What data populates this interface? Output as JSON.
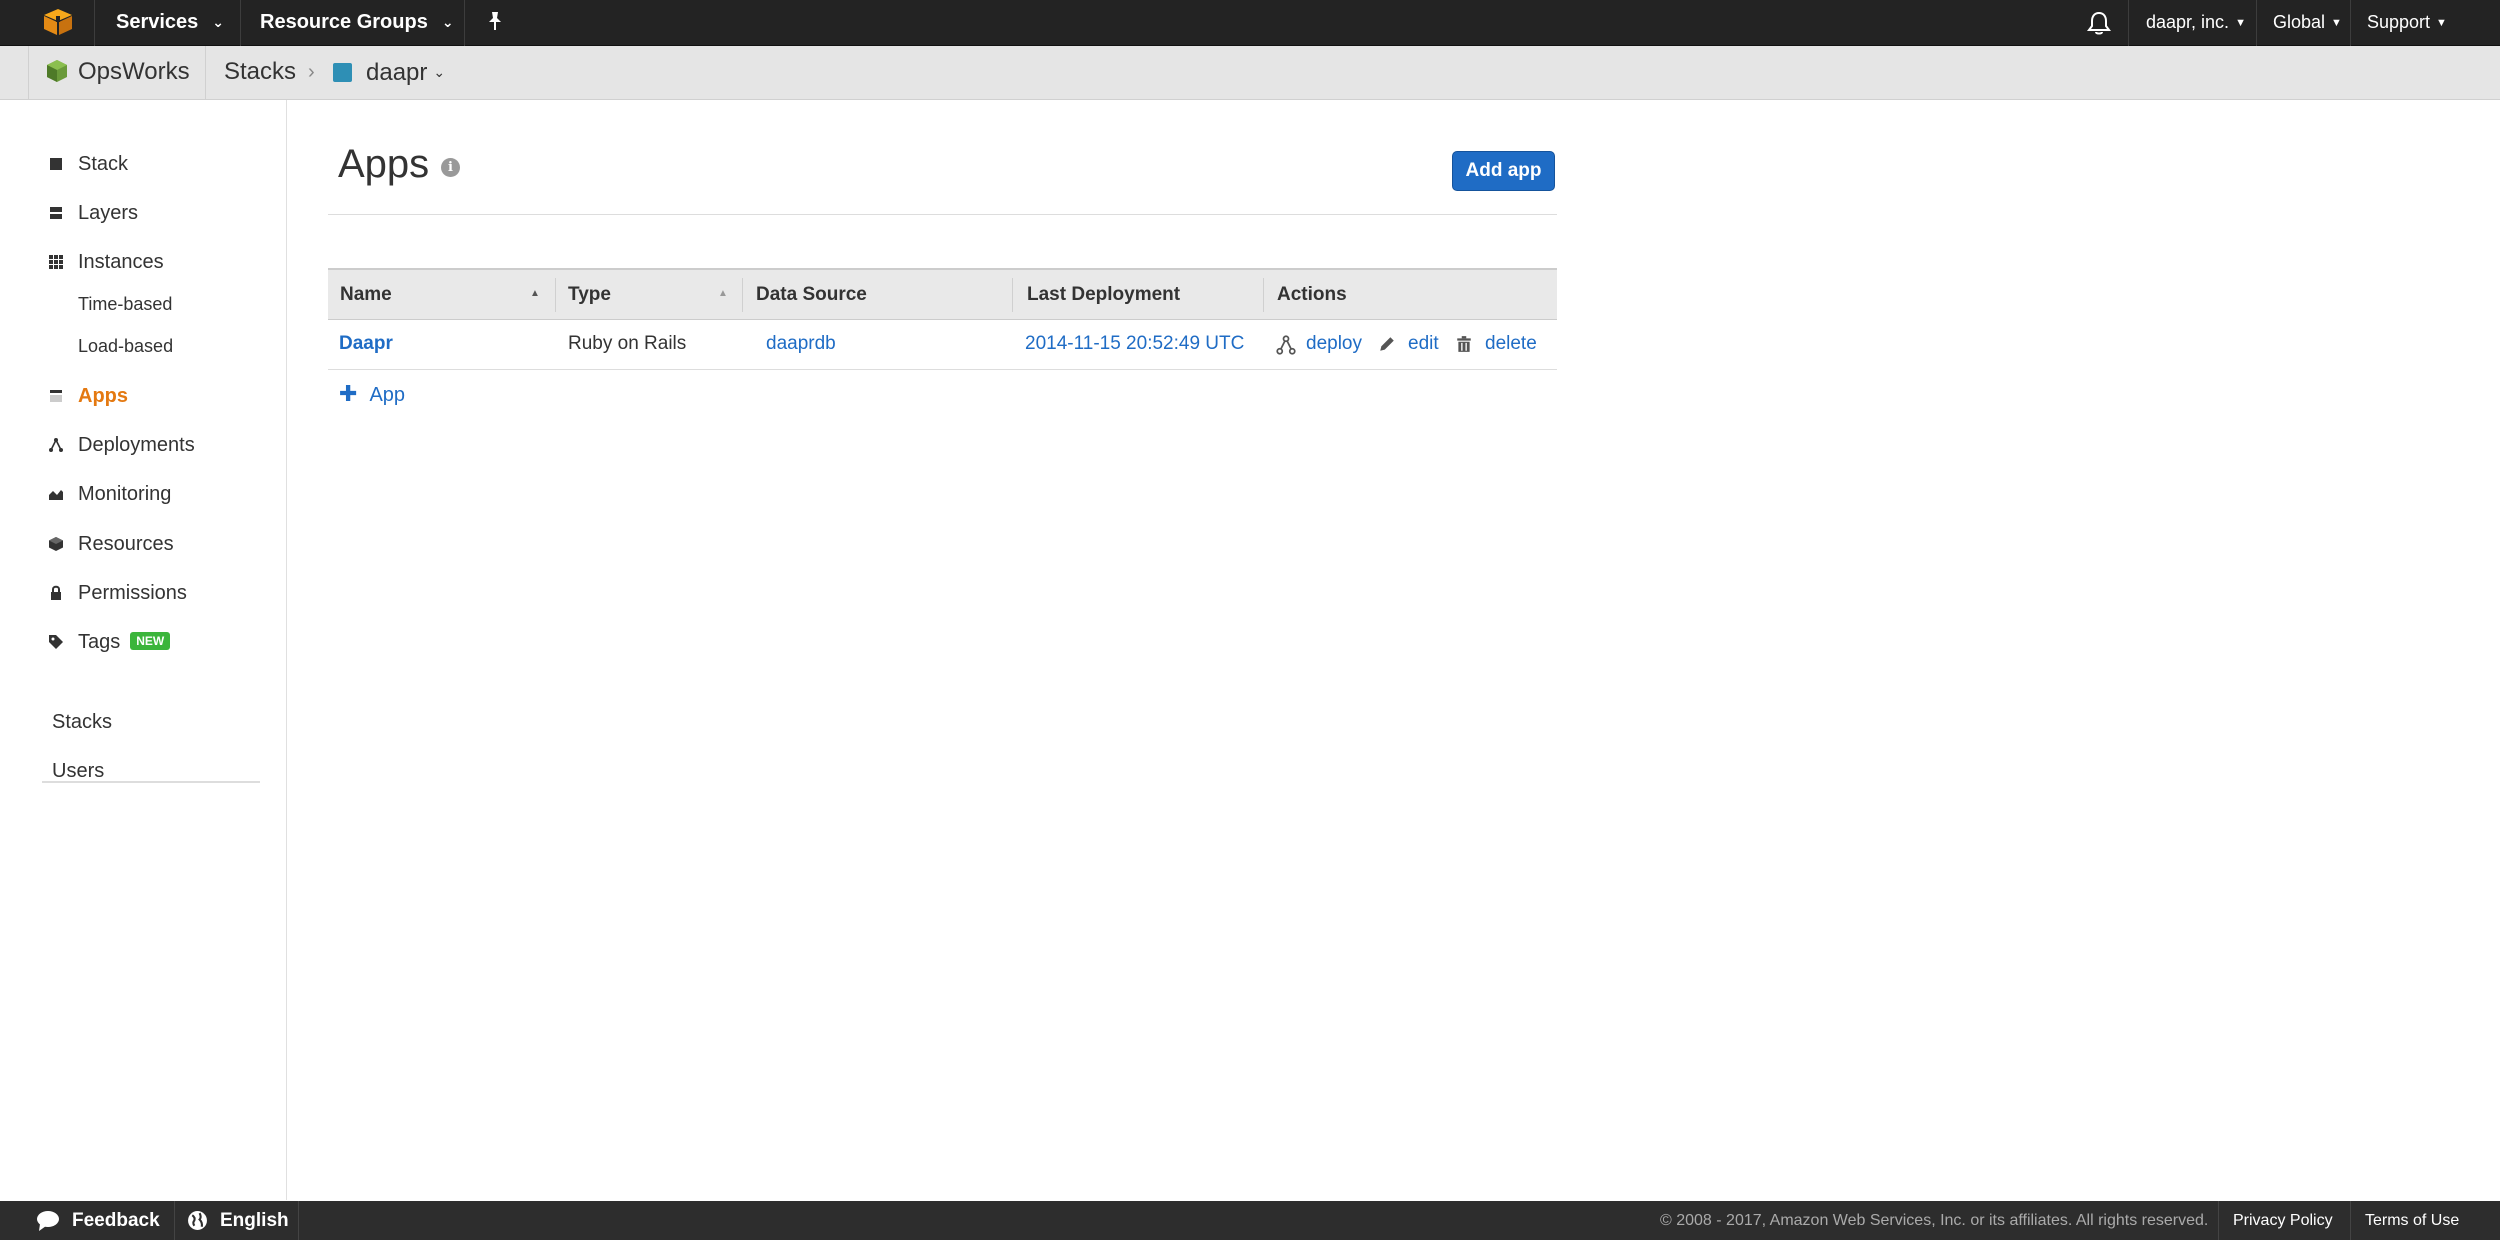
{
  "topnav": {
    "services": "Services",
    "resource_groups": "Resource Groups",
    "account": "daapr, inc.",
    "region": "Global",
    "support": "Support"
  },
  "servicebar": {
    "service_name": "OpsWorks",
    "crumb_stacks": "Stacks",
    "crumb_separator": "›",
    "stack_name": "daapr",
    "stack_color": "#2e8fb5"
  },
  "sidebar": {
    "items": [
      {
        "label": "Stack",
        "icon": "stack-icon"
      },
      {
        "label": "Layers",
        "icon": "layers-icon"
      },
      {
        "label": "Instances",
        "icon": "instances-icon"
      },
      {
        "label": "Apps",
        "icon": "apps-icon",
        "active": true
      },
      {
        "label": "Deployments",
        "icon": "deployments-icon"
      },
      {
        "label": "Monitoring",
        "icon": "monitoring-icon"
      },
      {
        "label": "Resources",
        "icon": "resources-icon"
      },
      {
        "label": "Permissions",
        "icon": "lock-icon"
      },
      {
        "label": "Tags",
        "icon": "tag-icon",
        "badge": "NEW"
      }
    ],
    "subitems": [
      "Time-based",
      "Load-based"
    ],
    "links": [
      "Stacks",
      "Users"
    ]
  },
  "main": {
    "title": "Apps",
    "info_glyph": "i",
    "add_button": "Add app",
    "table": {
      "columns": [
        "Name",
        "Type",
        "Data Source",
        "Last Deployment",
        "Actions"
      ],
      "rows": [
        {
          "name": "Daapr",
          "type": "Ruby on Rails",
          "data_source": "daaprdb",
          "last_deployment": "2014-11-15 20:52:49 UTC",
          "actions": [
            "deploy",
            "edit",
            "delete"
          ]
        }
      ]
    },
    "add_row_label": "App",
    "add_row_glyph": "✚"
  },
  "footer": {
    "feedback": "Feedback",
    "language": "English",
    "copyright": "© 2008 - 2017, Amazon Web Services, Inc. or its affiliates. All rights reserved.",
    "privacy": "Privacy Policy",
    "terms": "Terms of Use"
  },
  "colors": {
    "accent_link": "#1f6cc5",
    "active_nav": "#e47911",
    "topnav_bg": "#232323",
    "badge_green": "#3bb53b"
  }
}
